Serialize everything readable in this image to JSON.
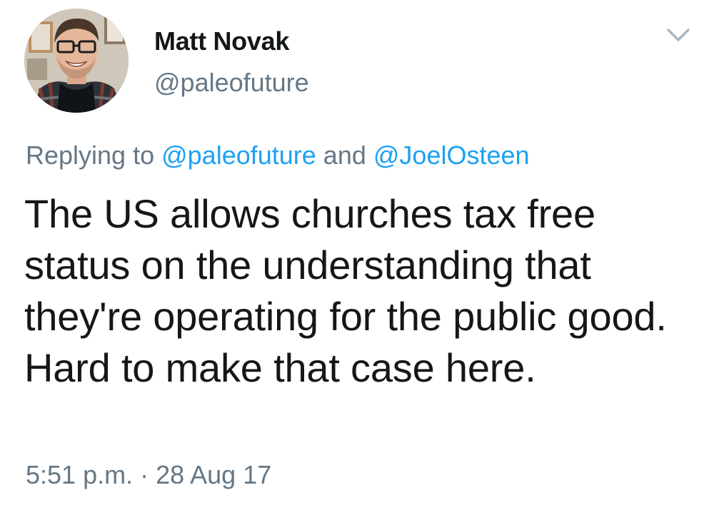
{
  "author": {
    "display_name": "Matt Novak",
    "handle": "@paleofuture",
    "avatar_icon": "profile-photo"
  },
  "menu": {
    "icon": "chevron-down-icon"
  },
  "reply": {
    "prefix": "Replying to ",
    "mention_1": "@paleofuture",
    "joiner": " and ",
    "mention_2": "@JoelOsteen"
  },
  "tweet": {
    "text": "The US allows churches tax free status on the understanding that they're operating for the public good. Hard to make that case here.",
    "timestamp": "5:51 p.m. · 28 Aug 17"
  },
  "colors": {
    "text_primary": "#14171a",
    "text_secondary": "#657786",
    "link": "#1da1f2",
    "background": "#ffffff"
  }
}
